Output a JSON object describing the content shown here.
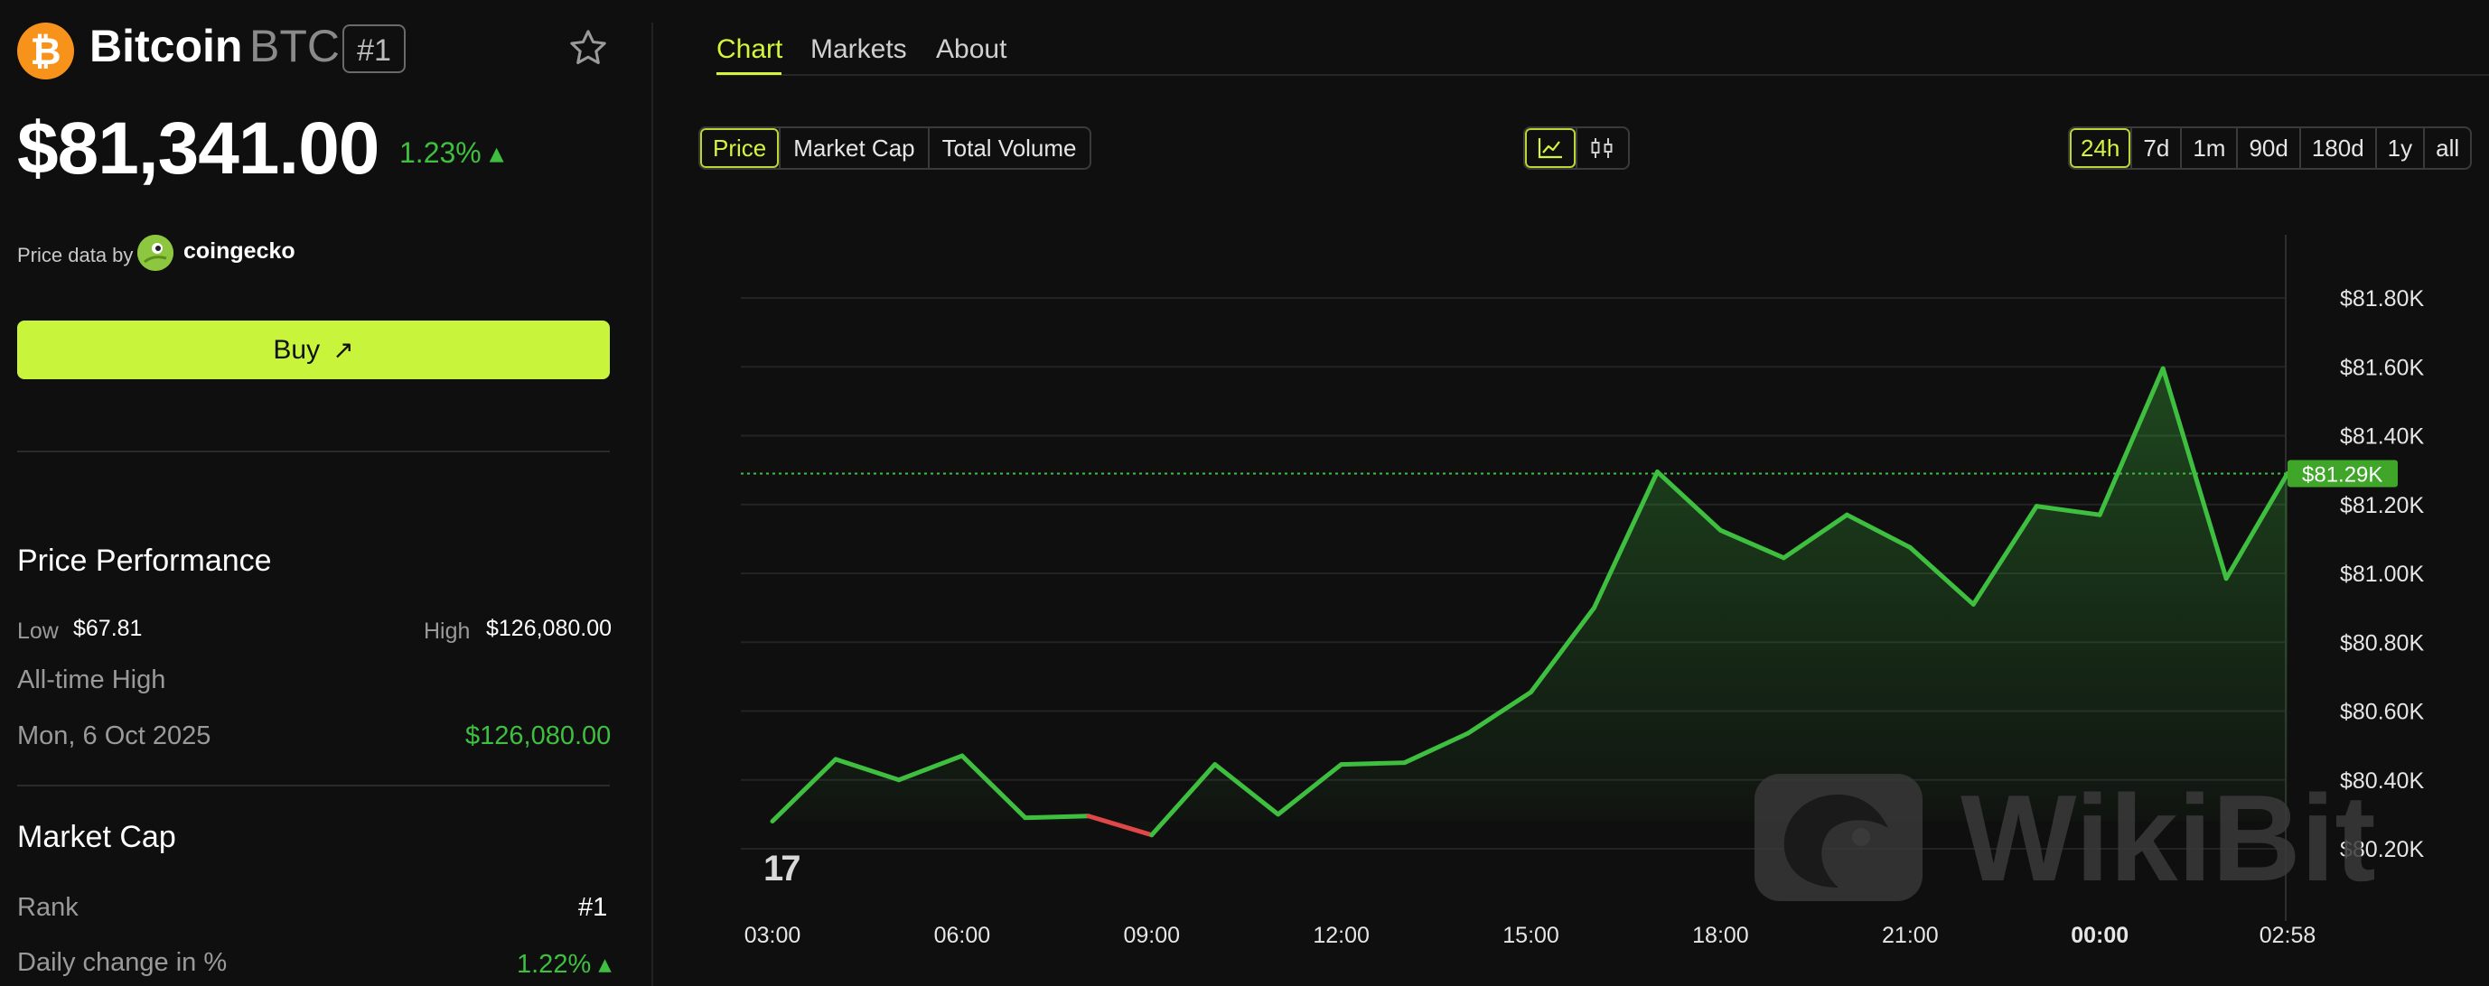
{
  "coin": {
    "logo_symbol": "₿",
    "name": "Bitcoin",
    "symbol": "BTC",
    "rank_badge": "#1",
    "price": "$81,341.00",
    "change": "1.23% ▴",
    "brand_color": "#f7931a"
  },
  "price_source": {
    "label": "Price data by",
    "provider": "coingecko"
  },
  "buy": {
    "label": "Buy",
    "arrow": "↗"
  },
  "performance": {
    "title": "Price Performance",
    "low_label": "Low",
    "low_value": "$67.81",
    "high_label": "High",
    "high_value": "$126,080.00",
    "ath_label": "All-time High",
    "ath_date": "Mon, 6 Oct 2025",
    "ath_value": "$126,080.00"
  },
  "market_cap": {
    "title": "Market Cap",
    "rank_label": "Rank",
    "rank_value": "#1",
    "daily_label": "Daily change in %",
    "daily_value": "1.22% ▴"
  },
  "tabs": {
    "chart": "Chart",
    "markets": "Markets",
    "about": "About"
  },
  "metric_buttons": [
    "Price",
    "Market Cap",
    "Total Volume"
  ],
  "metric_active": "Price",
  "range_buttons": [
    "24h",
    "7d",
    "1m",
    "90d",
    "180d",
    "1y",
    "all"
  ],
  "range_active": "24h",
  "view_icons": [
    "line-chart-icon",
    "candlestick-icon"
  ],
  "chart_brand": "17",
  "watermark_text": "WikiBit",
  "colors": {
    "accent": "#d4f53c",
    "up": "#3fbf3f",
    "down": "#e04848",
    "current_label_bg": "#3fa62a"
  },
  "chart_data": {
    "type": "line",
    "ylim": [
      80100,
      81900
    ],
    "yticks": [
      80200,
      80400,
      80600,
      80800,
      81000,
      81200,
      81400,
      81600,
      81800
    ],
    "ytick_labels": [
      "$80.20K",
      "$80.40K",
      "$80.60K",
      "$80.80K",
      "$81.00K",
      "$81.20K",
      "$81.40K",
      "$81.60K",
      "$81.80K"
    ],
    "x_labels": [
      "03:00",
      "06:00",
      "09:00",
      "12:00",
      "15:00",
      "18:00",
      "21:00",
      "00:00",
      "02:58"
    ],
    "x_label_hours": [
      0,
      3,
      6,
      9,
      12,
      15,
      18,
      21,
      23.97
    ],
    "bold_x_label": "00:00",
    "current_value": 81290,
    "current_label": "$81.29K",
    "down_segment_hours": [
      5,
      6
    ],
    "points": [
      {
        "h": 0,
        "v": 80280
      },
      {
        "h": 1,
        "v": 80460
      },
      {
        "h": 2,
        "v": 80400
      },
      {
        "h": 3,
        "v": 80470
      },
      {
        "h": 4,
        "v": 80290
      },
      {
        "h": 5,
        "v": 80295
      },
      {
        "h": 6,
        "v": 80240
      },
      {
        "h": 7,
        "v": 80445
      },
      {
        "h": 8,
        "v": 80300
      },
      {
        "h": 9,
        "v": 80445
      },
      {
        "h": 10,
        "v": 80450
      },
      {
        "h": 11,
        "v": 80535
      },
      {
        "h": 12,
        "v": 80655
      },
      {
        "h": 13,
        "v": 80900
      },
      {
        "h": 14,
        "v": 81295
      },
      {
        "h": 15,
        "v": 81125
      },
      {
        "h": 16,
        "v": 81045
      },
      {
        "h": 17,
        "v": 81170
      },
      {
        "h": 18,
        "v": 81075
      },
      {
        "h": 19,
        "v": 80910
      },
      {
        "h": 20,
        "v": 81195
      },
      {
        "h": 21,
        "v": 81170
      },
      {
        "h": 22,
        "v": 81595
      },
      {
        "h": 23,
        "v": 80985
      },
      {
        "h": 23.97,
        "v": 81290
      }
    ]
  }
}
